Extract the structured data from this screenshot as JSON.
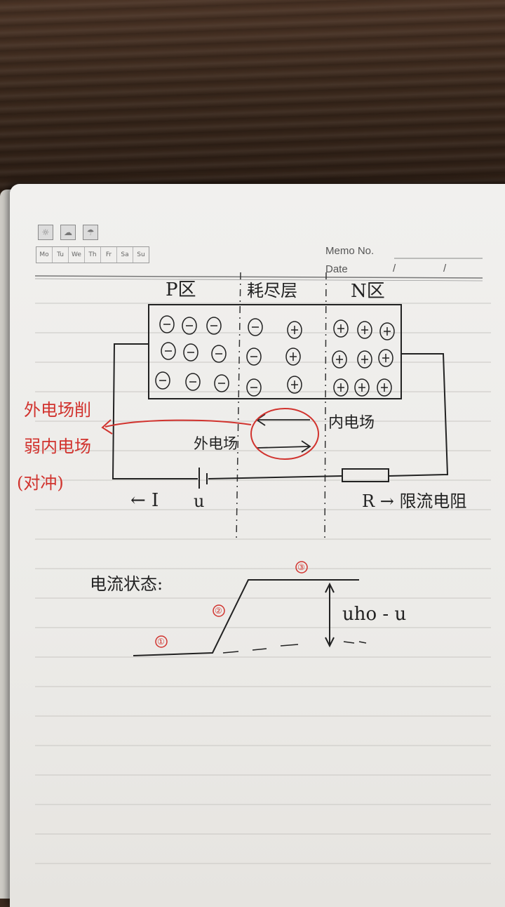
{
  "notebook": {
    "weekdays": [
      "Mo",
      "Tu",
      "We",
      "Th",
      "Fr",
      "Sa",
      "Su"
    ],
    "weather_icons": [
      "sunny-icon",
      "cloudy-icon",
      "rainy-icon"
    ],
    "memo_label": "Memo No.",
    "date_label": "Date",
    "date_separators": [
      "/",
      "/"
    ]
  },
  "diagram": {
    "p_region": "P区",
    "depletion_layer": "耗尽层",
    "n_region": "N区",
    "external_field": "外电场",
    "internal_field": "内电场",
    "current_label": "← I",
    "voltage_label": "u",
    "resistor_label": "R → 限流电阻",
    "annotation_lines": [
      "外电场削",
      "弱内电场",
      "(对冲)"
    ],
    "annotation_color": "#d1332e"
  },
  "current_graph": {
    "title": "电流状态:",
    "markers": [
      "①",
      "②",
      "③"
    ],
    "delta_label": "uho - u"
  }
}
